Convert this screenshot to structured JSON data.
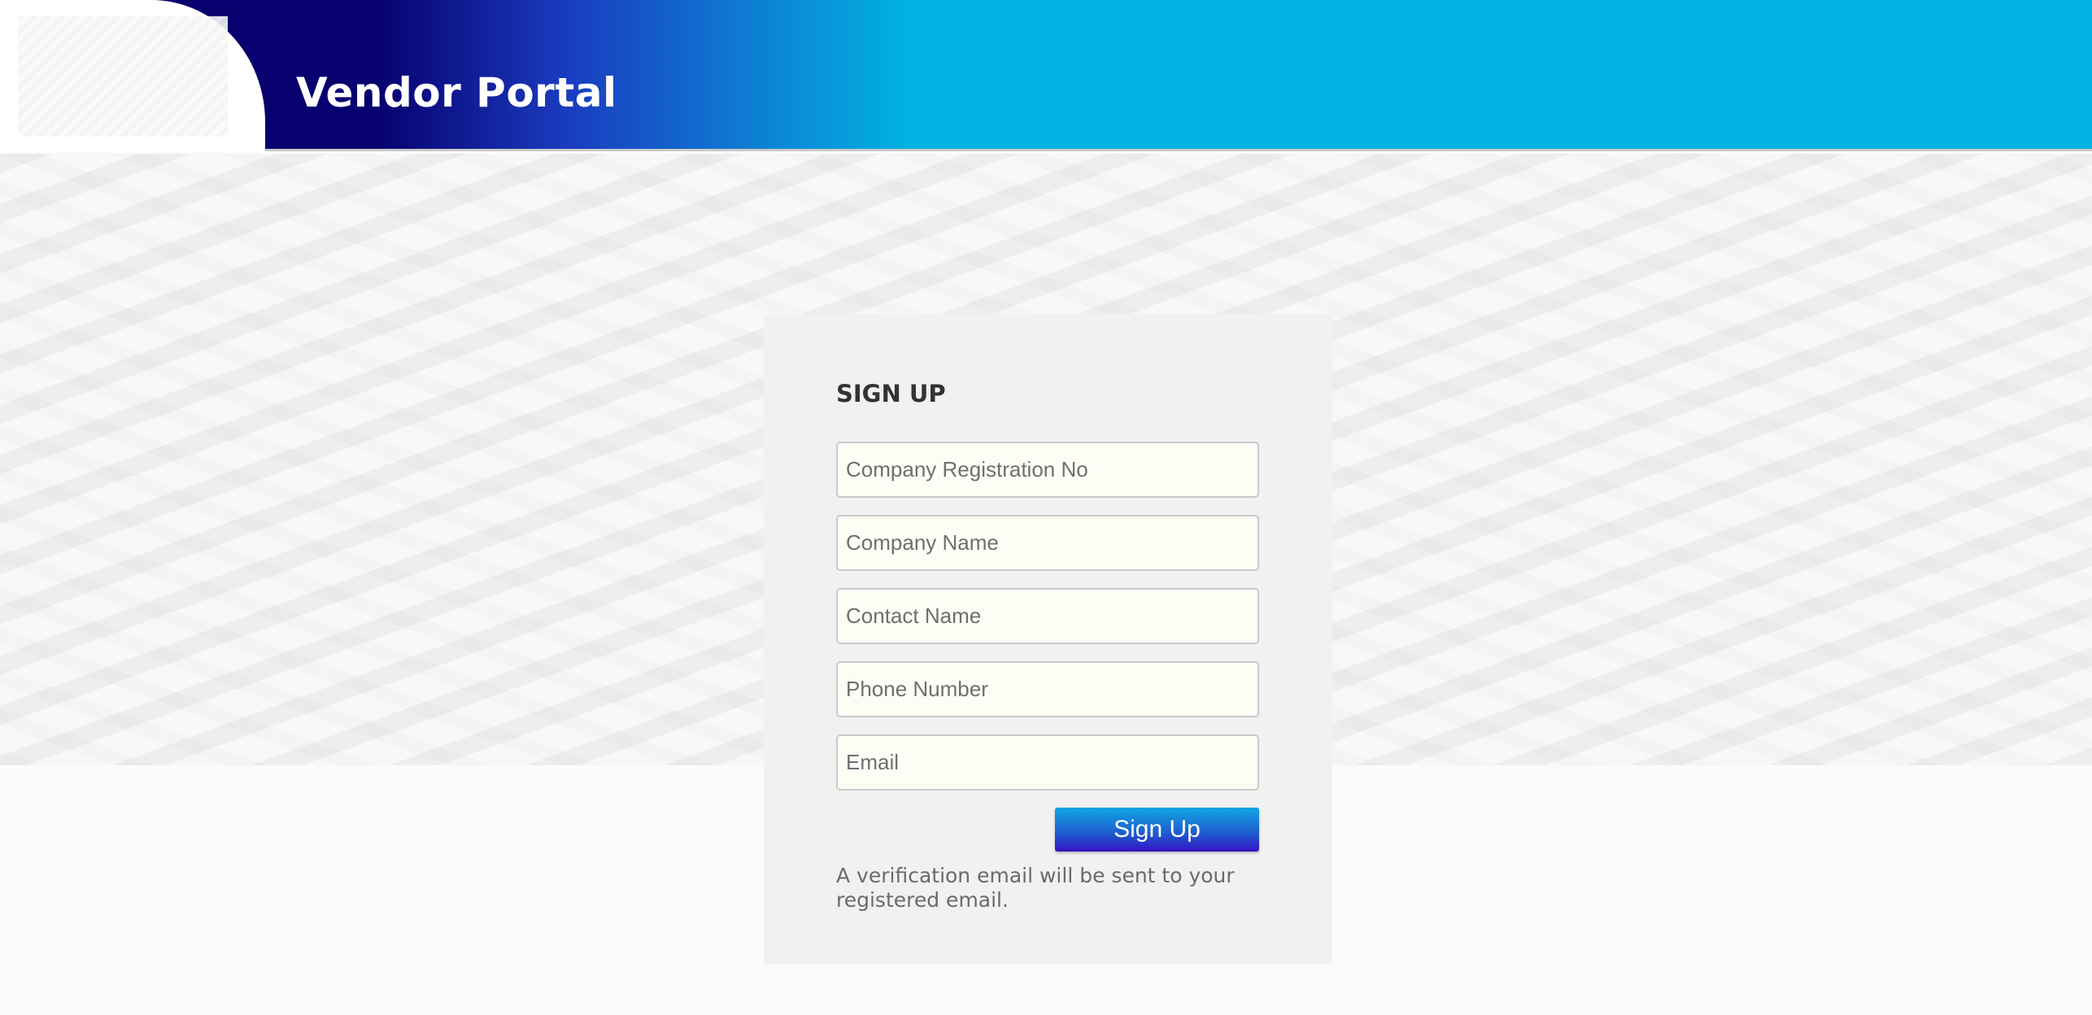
{
  "header": {
    "title": "Vendor Portal",
    "colors": {
      "gradient_start": "#07006e",
      "gradient_end": "#00b2e1"
    }
  },
  "signup": {
    "title": "SIGN UP",
    "fields": [
      {
        "name": "company-registration-no",
        "placeholder": "Company Registration No",
        "value": ""
      },
      {
        "name": "company-name",
        "placeholder": "Company Name",
        "value": ""
      },
      {
        "name": "contact-name",
        "placeholder": "Contact Name",
        "value": ""
      },
      {
        "name": "phone-number",
        "placeholder": "Phone Number",
        "value": ""
      },
      {
        "name": "email",
        "placeholder": "Email",
        "value": ""
      }
    ],
    "submit_label": "Sign Up",
    "note": "A verification email will be sent to your registered email."
  }
}
